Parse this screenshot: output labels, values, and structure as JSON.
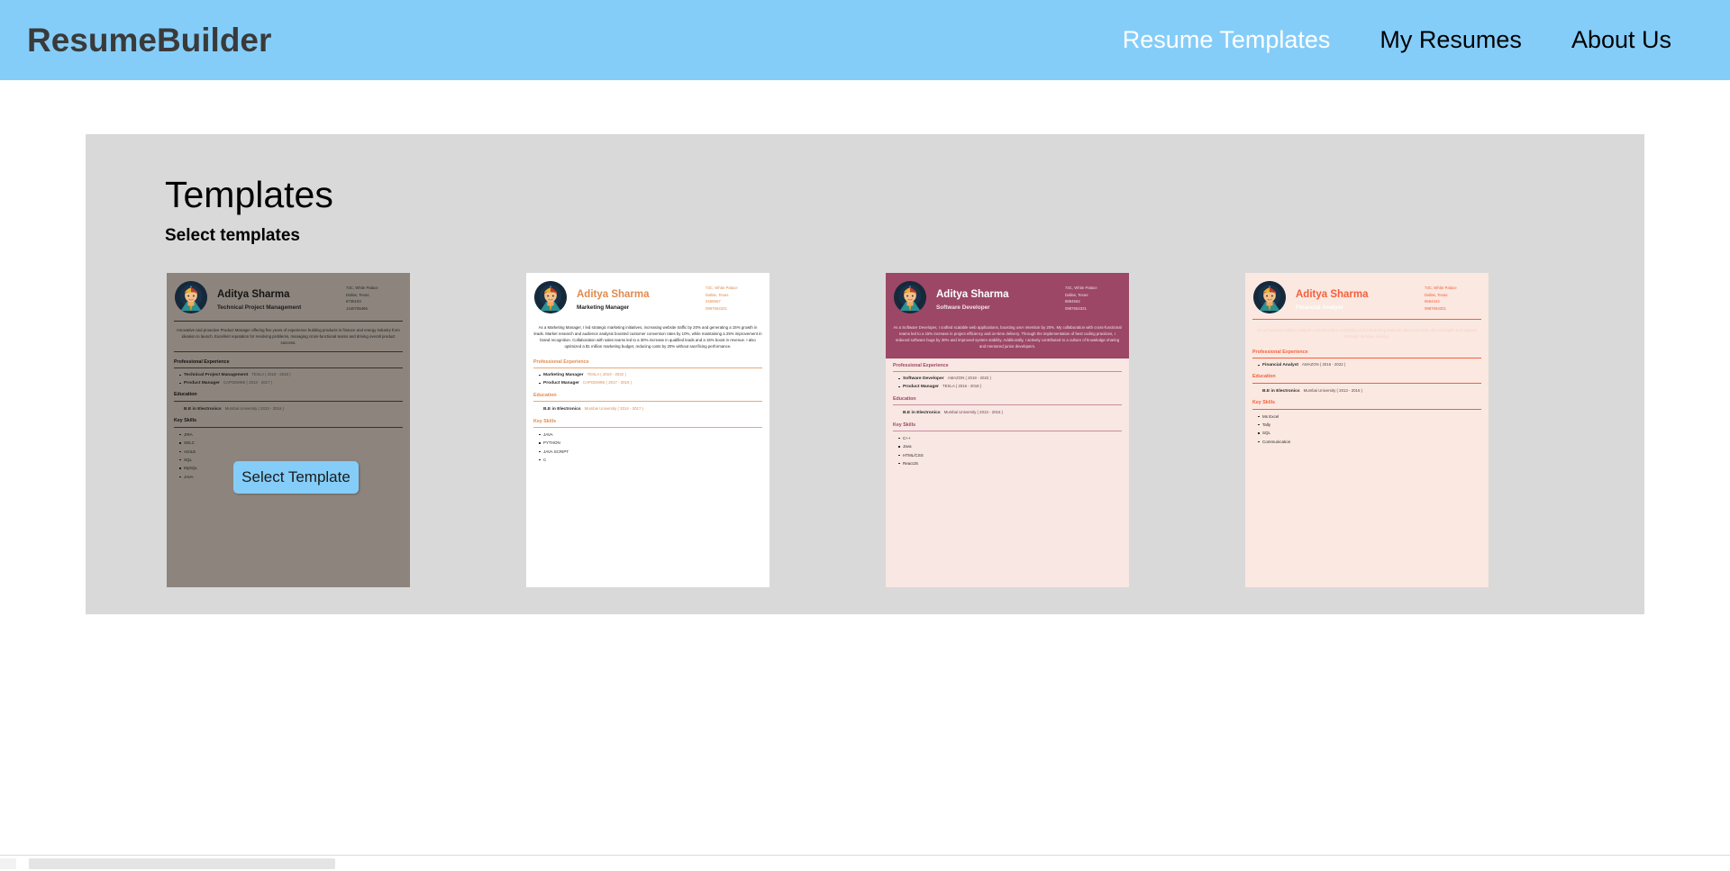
{
  "nav": {
    "brand": "ResumeBuilder",
    "links": [
      {
        "label": "Resume Templates",
        "active": true
      },
      {
        "label": "My Resumes",
        "active": false
      },
      {
        "label": "About Us",
        "active": false
      }
    ]
  },
  "page": {
    "title": "Templates",
    "subtitle": "Select templates",
    "select_button": "Select Template"
  },
  "labels": {
    "professional_experience": "Professional Experience",
    "education": "Education",
    "key_skills": "Key Skills"
  },
  "templates": [
    {
      "theme": "t1",
      "name": "Aditya Sharma",
      "role": "Technical Project Management",
      "contact": {
        "address": "73C, White Palace",
        "city": "Dallas, Texas",
        "id": "8735193",
        "phone": "1440765466"
      },
      "summary": "Innovative and proactive Product Manager offering five years of experience building products in finance and energy industry from ideation to launch. Excellent reputation for resolving problems, managing cross-functional teams and driving overall product success.",
      "experience": [
        {
          "title": "Technical Project Management",
          "meta": "TESLA ( 2019 - 2019 )"
        },
        {
          "title": "Product Manager",
          "meta": "CAPGEMINI ( 2013 - 2017 )"
        }
      ],
      "education": [
        {
          "degree": "B.E in Electronics",
          "school": "Mumbai University ( 2013 - 2016 )"
        }
      ],
      "skills": [
        "JIRA",
        "SDLC",
        "AGILE",
        "SQL",
        "MySQL",
        "JAVA"
      ]
    },
    {
      "theme": "t2",
      "name": "Aditya Sharma",
      "role": "Marketing Manager",
      "contact": {
        "address": "73C, White Palace",
        "city": "Dallas, Texas",
        "id": "3455567",
        "phone": "0987654321"
      },
      "summary": "As a Marketing Manager, I led strategic marketing initiatives, increasing website traffic by 20% and generating a 15% growth in leads. Market research and audience analysis boosted customer conversion rates by 10%, while maintaining a 25% improvement in brand recognition. Collaboration with sales teams led to a 30% increase in qualified leads and a 15% boost in revenue. I also optimized a $1 million marketing budget, reducing costs by 20% without sacrificing performance.",
      "experience": [
        {
          "title": "Marketing Manager",
          "meta": "TESLA ( 2019 - 2022 )"
        },
        {
          "title": "Product Manager",
          "meta": "CAPGEMINI ( 2017 - 2019 )"
        }
      ],
      "education": [
        {
          "degree": "B.E in Electronics",
          "school": "Mumbai University ( 2014 - 2017 )"
        }
      ],
      "skills": [
        "JAVA",
        "PYTHON",
        "JAVA SCRIPT",
        "C"
      ]
    },
    {
      "theme": "t3",
      "name": "Aditya Sharma",
      "role": "Software Developer",
      "contact": {
        "address": "73C, White Palace",
        "city": "Dallas, Texas",
        "id": "8884562",
        "phone": "0987654321"
      },
      "summary": "As a Software Developer, I crafted scalable web applications, boosting user retention by 20%. My collaboration with cross-functional teams led to a 15% increase in project efficiency and on-time delivery. Through the implementation of best coding practices, I reduced software bugs by 30% and improved system stability. Additionally, I actively contributed to a culture of knowledge sharing and mentored junior developers.",
      "experience": [
        {
          "title": "Software Developer",
          "meta": "AMAZON ( 2019 - 2022 )"
        },
        {
          "title": "Product Manager",
          "meta": "TESLA ( 2016 - 2018 )"
        }
      ],
      "education": [
        {
          "degree": "B.E in Electronics",
          "school": "Mumbai University ( 2013 - 2016 )"
        }
      ],
      "skills": [
        "C++",
        "Java",
        "HTML/CSS",
        "ReactJS"
      ]
    },
    {
      "theme": "t4",
      "name": "Aditya Sharma",
      "role": "Financial Analyst",
      "contact": {
        "address": "73C, White Palace",
        "city": "Dallas, Texas",
        "id": "6664444",
        "phone": "0987654321"
      },
      "summary": "As a Financial Analyst, I played a pivotal role in evaluating and interpreting financial data to provide critical insights and support strategic decision making.",
      "experience": [
        {
          "title": "Financial Analyst",
          "meta": "AMAZON ( 2016 - 2022 )"
        }
      ],
      "education": [
        {
          "degree": "B.E in Electronics",
          "school": "Mumbai University ( 2013 - 2016 )"
        }
      ],
      "skills": [
        "Ms Excel",
        "Tally",
        "SQL",
        "Communication"
      ]
    }
  ],
  "colors": {
    "nav_background": "#85CDF9",
    "panel_background": "#d9d9d9",
    "button_background": "#85CDF9",
    "theme_1": "#8d857d",
    "theme_2": "#ffffff",
    "theme_3": "#9C4766",
    "theme_4": "#F4603C"
  }
}
